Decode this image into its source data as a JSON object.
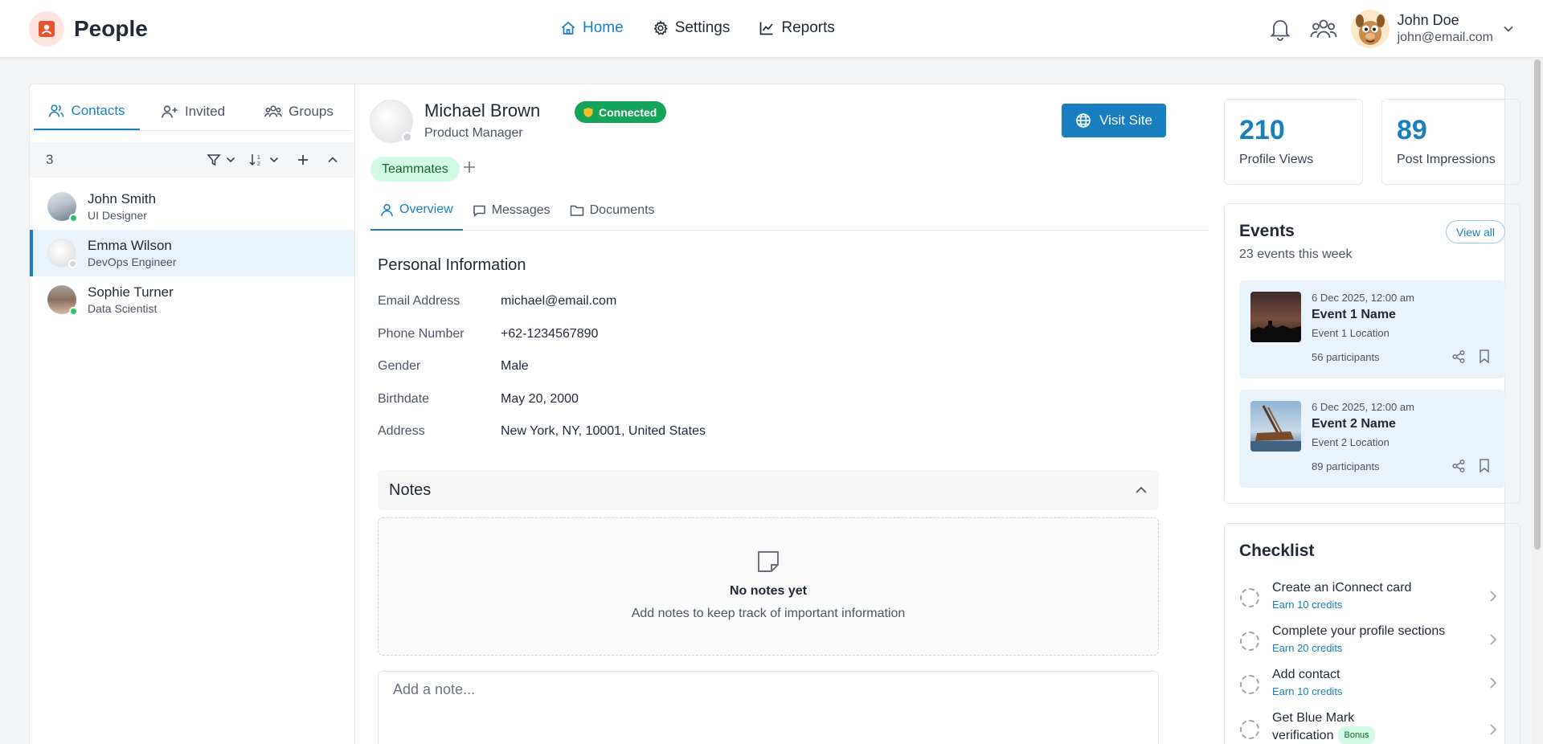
{
  "app": {
    "name": "People"
  },
  "nav": [
    {
      "label": "Home",
      "active": true
    },
    {
      "label": "Settings",
      "active": false
    },
    {
      "label": "Reports",
      "active": false
    }
  ],
  "user": {
    "name": "John Doe",
    "email": "john@email.com"
  },
  "contacts_panel": {
    "tabs": [
      {
        "label": "Contacts",
        "active": true
      },
      {
        "label": "Invited",
        "active": false
      },
      {
        "label": "Groups",
        "active": false
      }
    ],
    "count": "3",
    "items": [
      {
        "name": "John Smith",
        "role": "UI Designer",
        "status": "online",
        "selected": false
      },
      {
        "name": "Emma Wilson",
        "role": "DevOps Engineer",
        "status": "offline",
        "selected": true
      },
      {
        "name": "Sophie Turner",
        "role": "Data Scientist",
        "status": "online",
        "selected": false
      }
    ]
  },
  "profile": {
    "name": "Michael Brown",
    "badge": "Connected",
    "title": "Product Manager",
    "visit_label": "Visit Site",
    "tag": "Teammates",
    "tabs": [
      {
        "label": "Overview",
        "active": true
      },
      {
        "label": "Messages",
        "active": false
      },
      {
        "label": "Documents",
        "active": false
      }
    ],
    "section_title": "Personal Information",
    "info": [
      {
        "label": "Email Address",
        "value": "michael@email.com"
      },
      {
        "label": "Phone Number",
        "value": "+62-1234567890"
      },
      {
        "label": "Gender",
        "value": "Male"
      },
      {
        "label": "Birthdate",
        "value": "May 20, 2000"
      },
      {
        "label": "Address",
        "value": "New York, NY, 10001, United States"
      }
    ],
    "notes": {
      "title": "Notes",
      "empty_title": "No notes yet",
      "empty_sub": "Add notes to keep track of important information",
      "placeholder": "Add a note..."
    }
  },
  "stats": [
    {
      "value": "210",
      "label": "Profile Views"
    },
    {
      "value": "89",
      "label": "Post Impressions"
    }
  ],
  "events": {
    "title": "Events",
    "view_all": "View all",
    "subtitle": "23 events this week",
    "items": [
      {
        "date": "6 Dec 2025, 12:00 am",
        "name": "Event 1 Name",
        "location": "Event 1 Location",
        "participants": "56 participants"
      },
      {
        "date": "6 Dec 2025, 12:00 am",
        "name": "Event 2 Name",
        "location": "Event 2 Location",
        "participants": "89 participants"
      }
    ]
  },
  "checklist": {
    "title": "Checklist",
    "items": [
      {
        "title": "Create an iConnect card",
        "sub": "Earn 10 credits"
      },
      {
        "title": "Complete your profile sections",
        "sub": "Earn 20 credits"
      },
      {
        "title": "Add contact",
        "sub": "Earn 10 credits"
      },
      {
        "title": "Get Blue Mark verification",
        "title_line1": "Get Blue Mark",
        "title_line2": "verification",
        "badge": "Bonus"
      }
    ]
  },
  "colors": {
    "accent": "#1a7fc1",
    "online": "#22c55e",
    "connected": "#15a35a"
  }
}
